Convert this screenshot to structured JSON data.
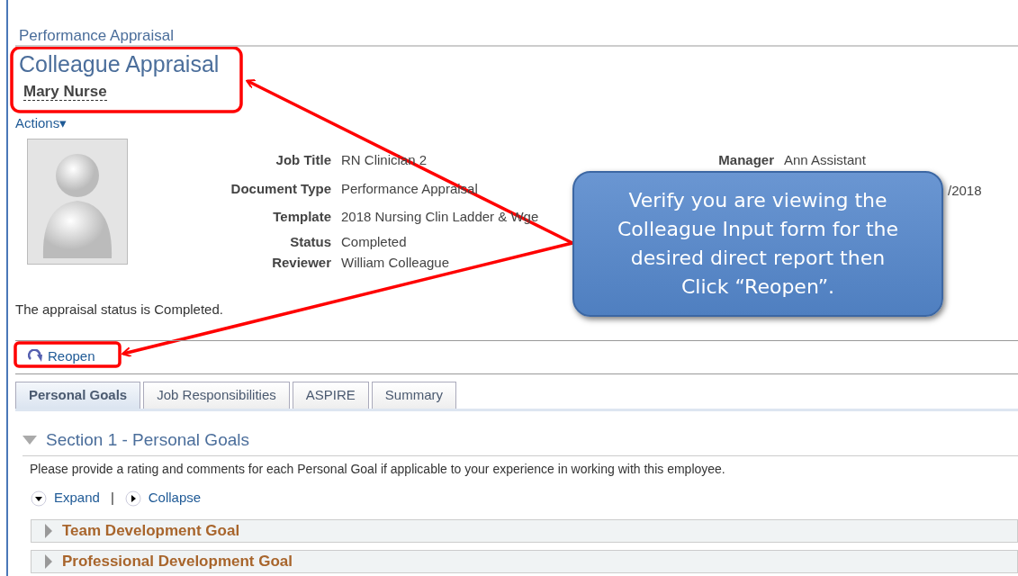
{
  "breadcrumb": "Performance Appraisal",
  "title": "Colleague Appraisal",
  "employee_name": "Mary Nurse",
  "actions_menu": {
    "label": "Actions",
    "caret": "▾"
  },
  "details": [
    {
      "label": "Job Title",
      "value": "RN Clinician 2"
    },
    {
      "label": "Document Type",
      "value": "Performance Appraisal"
    },
    {
      "label": "Template",
      "value": "2018 Nursing Clin Ladder & Wge"
    },
    {
      "label": "Status",
      "value": "Completed"
    },
    {
      "label": "Reviewer",
      "value": "William Colleague"
    }
  ],
  "manager": {
    "label": "Manager",
    "value": "Ann Assistant"
  },
  "partial_date": "/2018",
  "status_message": "The appraisal status is Completed.",
  "reopen_button": "Reopen",
  "tabs": [
    {
      "label": "Personal Goals",
      "selected": true
    },
    {
      "label": "Job Responsibilities",
      "selected": false
    },
    {
      "label": "ASPIRE",
      "selected": false
    },
    {
      "label": "Summary",
      "selected": false
    }
  ],
  "section": {
    "title": "Section 1 - Personal Goals",
    "expanded": true,
    "instruction": "Please provide a rating and comments for each Personal Goal if applicable to your experience in working with this employee.",
    "expand": "Expand",
    "separator": "|",
    "collapse": "Collapse",
    "goals": [
      {
        "title": "Team Development Goal",
        "expanded": false
      },
      {
        "title": "Professional Development Goal",
        "expanded": false
      }
    ]
  },
  "callout": {
    "text": "Verify you are viewing the Colleague Input form for the desired direct report then Click “Reopen”."
  }
}
